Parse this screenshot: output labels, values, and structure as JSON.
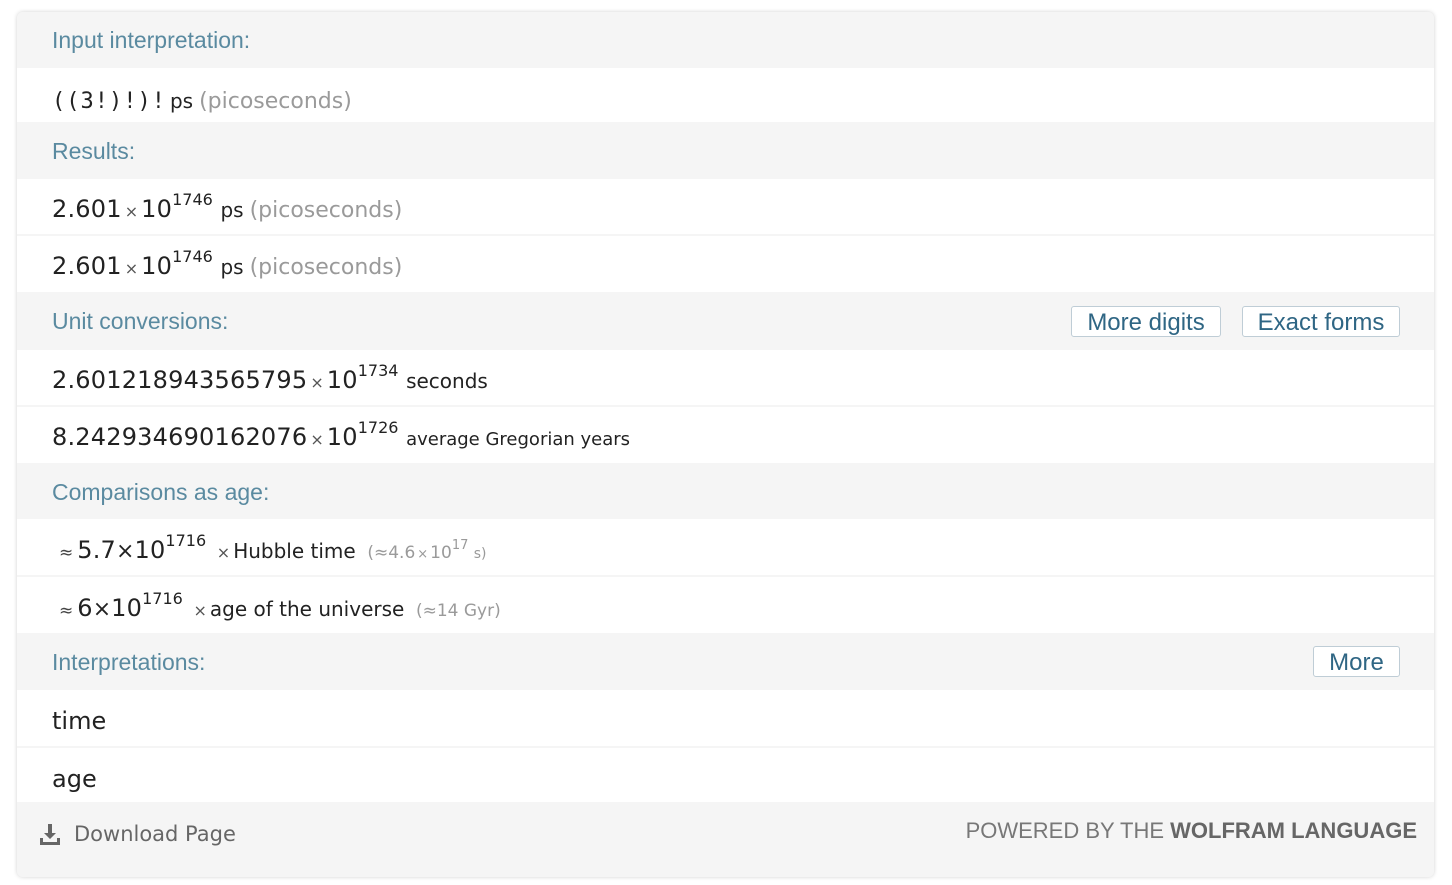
{
  "pods": {
    "input": {
      "title": "Input interpretation:",
      "expr": "((3!)!)!",
      "unit": "ps",
      "paren": "(picoseconds)"
    },
    "results": {
      "title": "Results:",
      "rows": [
        {
          "mantissa": "2.601",
          "base": "10",
          "exponent": "1746",
          "unit": "ps",
          "paren": "(picoseconds)"
        },
        {
          "mantissa": "2.601",
          "base": "10",
          "exponent": "1746",
          "unit": "ps",
          "paren": "(picoseconds)"
        }
      ]
    },
    "unit_conversions": {
      "title": "Unit conversions:",
      "buttons": {
        "more_digits": "More digits",
        "exact_forms": "Exact forms"
      },
      "rows": [
        {
          "mantissa": "2.601218943565795",
          "base": "10",
          "exponent": "1734",
          "unit": "seconds"
        },
        {
          "mantissa": "8.242934690162076",
          "base": "10",
          "exponent": "1726",
          "unit": "average Gregorian years"
        }
      ]
    },
    "comparisons": {
      "title": "Comparisons as age:",
      "rows": [
        {
          "approx": "≈",
          "mantissa": "5.7",
          "base": "10",
          "exponent": "1716",
          "label": "Hubble time",
          "paren_open": "(≈4.6",
          "paren_base": "10",
          "paren_exp": "17",
          "paren_close": "s)"
        },
        {
          "approx": "≈",
          "mantissa": "6",
          "base": "10",
          "exponent": "1716",
          "label": "age of the universe",
          "paren": "(≈14 Gyr)"
        }
      ]
    },
    "interpretations": {
      "title": "Interpretations:",
      "more_button": "More",
      "rows": [
        "time",
        "age"
      ]
    }
  },
  "symbols": {
    "times": "×"
  },
  "footer": {
    "download": "Download Page",
    "powered_prefix": "POWERED BY THE",
    "powered_brand": "WOLFRAM LANGUAGE"
  }
}
